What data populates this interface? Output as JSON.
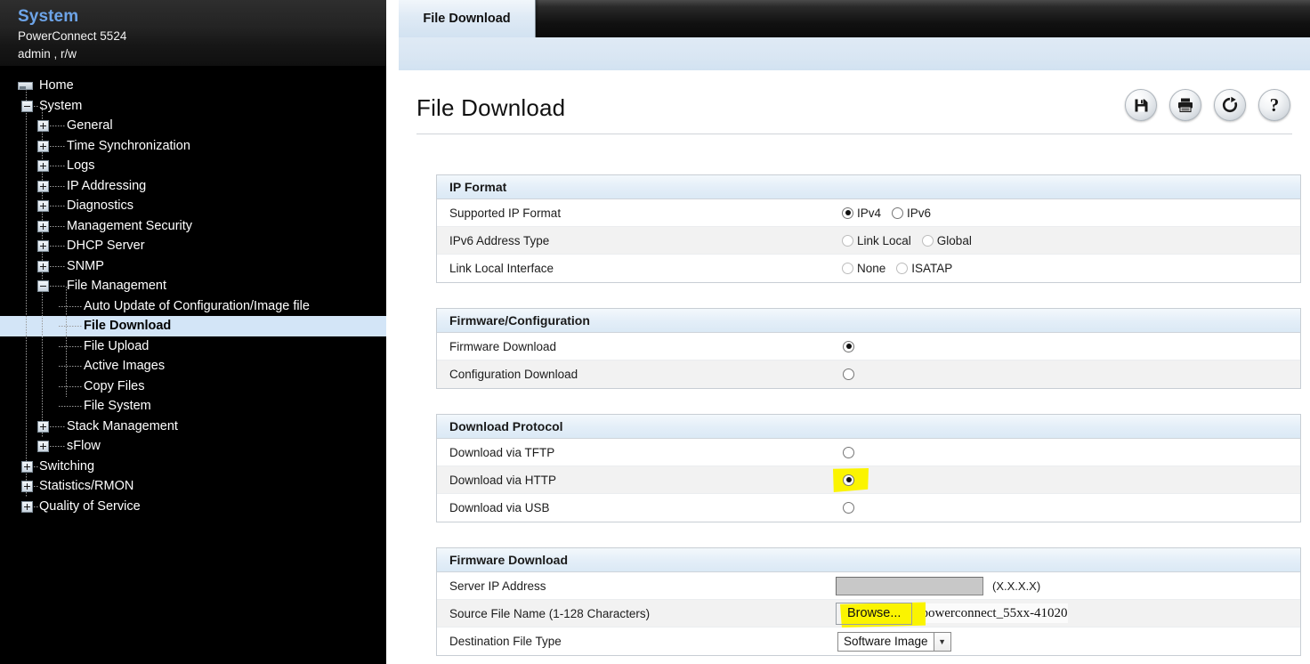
{
  "sidebar": {
    "header": {
      "title": "System",
      "model": "PowerConnect 5524",
      "user": "admin , r/w"
    },
    "tree": [
      {
        "label": "Home",
        "depth": 0,
        "icon": "home-icon",
        "expander": "none"
      },
      {
        "label": "System",
        "depth": 0,
        "icon": "none",
        "expander": "minus"
      },
      {
        "label": "General",
        "depth": 1,
        "icon": "none",
        "expander": "plus"
      },
      {
        "label": "Time Synchronization",
        "depth": 1,
        "icon": "none",
        "expander": "plus"
      },
      {
        "label": "Logs",
        "depth": 1,
        "icon": "none",
        "expander": "plus"
      },
      {
        "label": "IP Addressing",
        "depth": 1,
        "icon": "none",
        "expander": "plus"
      },
      {
        "label": "Diagnostics",
        "depth": 1,
        "icon": "none",
        "expander": "plus"
      },
      {
        "label": "Management Security",
        "depth": 1,
        "icon": "none",
        "expander": "plus"
      },
      {
        "label": "DHCP Server",
        "depth": 1,
        "icon": "none",
        "expander": "plus"
      },
      {
        "label": "SNMP",
        "depth": 1,
        "icon": "none",
        "expander": "plus"
      },
      {
        "label": "File Management",
        "depth": 1,
        "icon": "none",
        "expander": "minus"
      },
      {
        "label": "Auto Update of Configuration/Image file",
        "depth": 2,
        "icon": "none",
        "expander": "none"
      },
      {
        "label": "File Download",
        "depth": 2,
        "icon": "none",
        "expander": "none",
        "selected": true
      },
      {
        "label": "File Upload",
        "depth": 2,
        "icon": "none",
        "expander": "none"
      },
      {
        "label": "Active Images",
        "depth": 2,
        "icon": "none",
        "expander": "none"
      },
      {
        "label": "Copy Files",
        "depth": 2,
        "icon": "none",
        "expander": "none"
      },
      {
        "label": "File System",
        "depth": 2,
        "icon": "none",
        "expander": "none"
      },
      {
        "label": "Stack Management",
        "depth": 1,
        "icon": "none",
        "expander": "plus"
      },
      {
        "label": "sFlow",
        "depth": 1,
        "icon": "none",
        "expander": "plus"
      },
      {
        "label": "Switching",
        "depth": 0,
        "icon": "none",
        "expander": "plus"
      },
      {
        "label": "Statistics/RMON",
        "depth": 0,
        "icon": "none",
        "expander": "plus"
      },
      {
        "label": "Quality of Service",
        "depth": 0,
        "icon": "none",
        "expander": "plus"
      }
    ]
  },
  "main": {
    "tab_label": "File Download",
    "page_title": "File Download",
    "toolbar_icons": [
      "save-icon",
      "print-icon",
      "refresh-icon",
      "help-icon"
    ],
    "ip_format": {
      "title": "IP Format",
      "rows": [
        {
          "label": "Supported IP Format",
          "options": [
            {
              "label": "IPv4",
              "selected": true,
              "disabled": false
            },
            {
              "label": "IPv6",
              "selected": false,
              "disabled": false
            }
          ]
        },
        {
          "label": "IPv6 Address Type",
          "options": [
            {
              "label": "Link Local",
              "selected": false,
              "disabled": true
            },
            {
              "label": "Global",
              "selected": false,
              "disabled": true
            }
          ]
        },
        {
          "label": "Link Local Interface",
          "options": [
            {
              "label": "None",
              "selected": false,
              "disabled": true
            },
            {
              "label": "ISATAP",
              "selected": false,
              "disabled": true
            }
          ]
        }
      ]
    },
    "firmware_configuration": {
      "title": "Firmware/Configuration",
      "rows": [
        {
          "label": "Firmware Download",
          "selected": true
        },
        {
          "label": "Configuration Download",
          "selected": false
        }
      ]
    },
    "download_protocol": {
      "title": "Download Protocol",
      "rows": [
        {
          "label": "Download via TFTP",
          "selected": false,
          "highlighted": false
        },
        {
          "label": "Download via HTTP",
          "selected": true,
          "highlighted": true
        },
        {
          "label": "Download via USB",
          "selected": false,
          "highlighted": false
        }
      ]
    },
    "firmware_download": {
      "title": "Firmware Download",
      "server_ip": {
        "label": "Server IP Address",
        "value": "",
        "hint": "(X.X.X.X)",
        "disabled": true
      },
      "source_file": {
        "label": "Source File Name (1-128 Characters)",
        "browse_label": "Browse...",
        "browse_highlighted": true,
        "filename": "powerconnect_55xx-41020"
      },
      "destination_file_type": {
        "label": "Destination File Type",
        "value": "Software Image"
      }
    }
  },
  "colors": {
    "accent_blue": "#6da4e8",
    "selection_blue": "#d3e5f7",
    "highlight_yellow": "#fbf400",
    "panel_border": "#c8ced4",
    "row_alt": "#f2f2f2"
  }
}
